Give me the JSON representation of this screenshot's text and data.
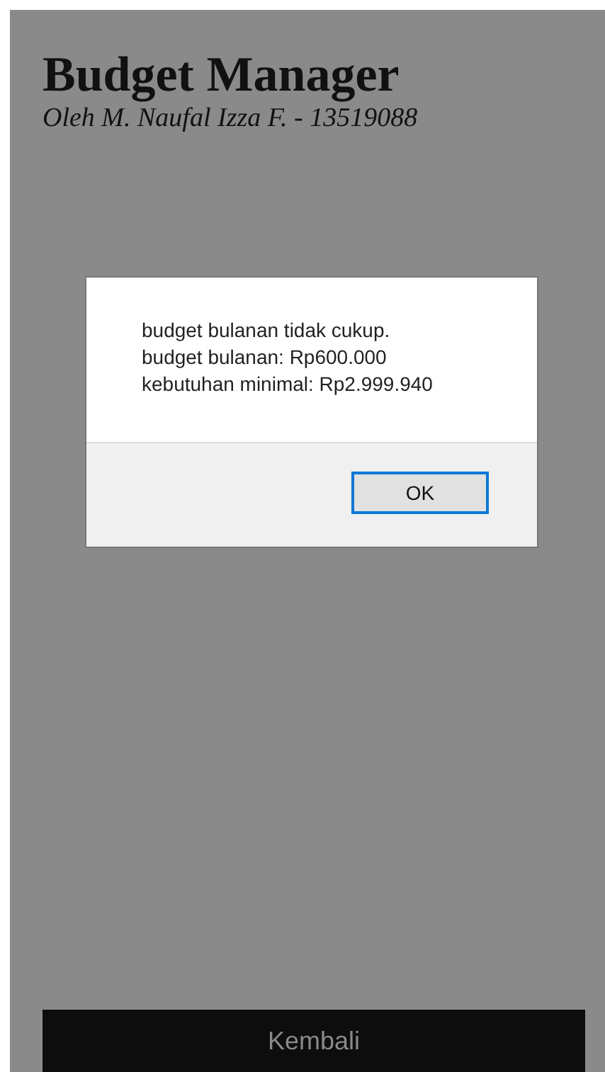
{
  "page": {
    "title": "Budget Manager",
    "subtitle": "Oleh M. Naufal Izza F. - 13519088",
    "back_button": "Kembali"
  },
  "dialog": {
    "message_lines": [
      "budget bulanan tidak cukup.",
      "budget bulanan: Rp600.000",
      "kebutuhan minimal: Rp2.999.940"
    ],
    "ok_button": "OK"
  }
}
